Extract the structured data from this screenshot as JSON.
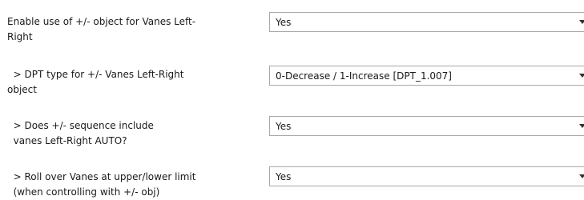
{
  "params": [
    {
      "label_line1": "Enable use of +/- object for Vanes Left-",
      "label_line2": "Right",
      "value": "Yes"
    },
    {
      "label_line1": "  > DPT type for +/- Vanes Left-Right",
      "label_line2": "object",
      "value": "0-Decrease / 1-Increase [DPT_1.007]"
    },
    {
      "label_line1": "  > Does +/- sequence include",
      "label_line2": "  vanes Left-Right AUTO?",
      "value": "Yes"
    },
    {
      "label_line1": "  > Roll over Vanes at upper/lower limit",
      "label_line2": "  (when controlling with +/- obj)",
      "value": "Yes"
    }
  ],
  "icons": {
    "dropdown": "chevron-down-icon"
  }
}
